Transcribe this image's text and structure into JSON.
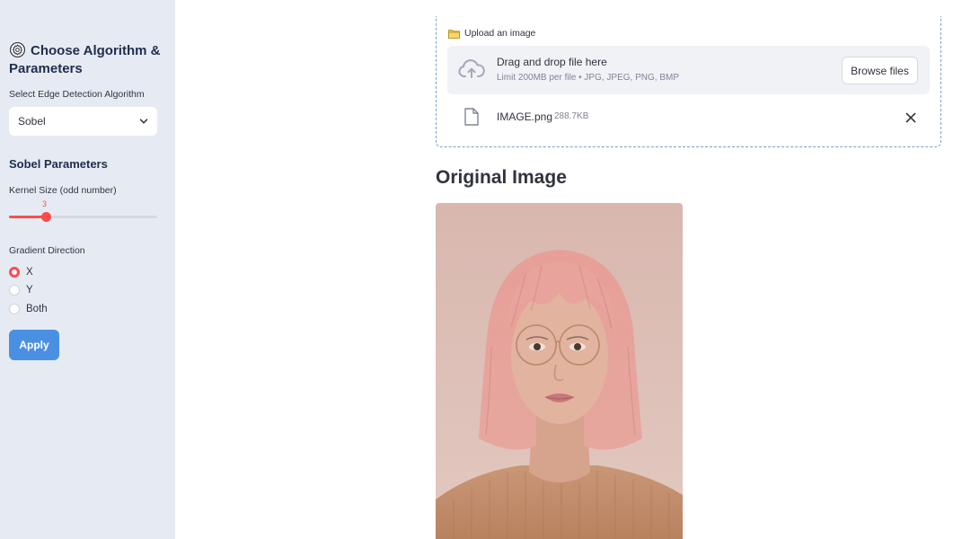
{
  "sidebar": {
    "title": "Choose Algorithm & Parameters",
    "title_icon": "gear-icon",
    "algorithm_label": "Select Edge Detection Algorithm",
    "algorithm_value": "Sobel",
    "params_heading": "Sobel Parameters",
    "kernel_label": "Kernel Size (odd number)",
    "kernel_value": "3",
    "kernel_fraction": 0.25,
    "gradient_label": "Gradient Direction",
    "gradient_options": [
      "X",
      "Y",
      "Both"
    ],
    "gradient_selected": "X",
    "apply_label": "Apply"
  },
  "uploader": {
    "label": "Upload an image",
    "label_icon": "folder-icon",
    "drop_main": "Drag and drop file here",
    "drop_sub": "Limit 200MB per file • JPG, JPEG, PNG, BMP",
    "browse_label": "Browse files",
    "file_name": "IMAGE.png",
    "file_size": "288.7KB"
  },
  "main": {
    "heading": "Original Image"
  },
  "colors": {
    "accent": "#ff4b4b",
    "apply_button": "#4a90e2",
    "sidebar_bg": "#e6ebf3"
  }
}
